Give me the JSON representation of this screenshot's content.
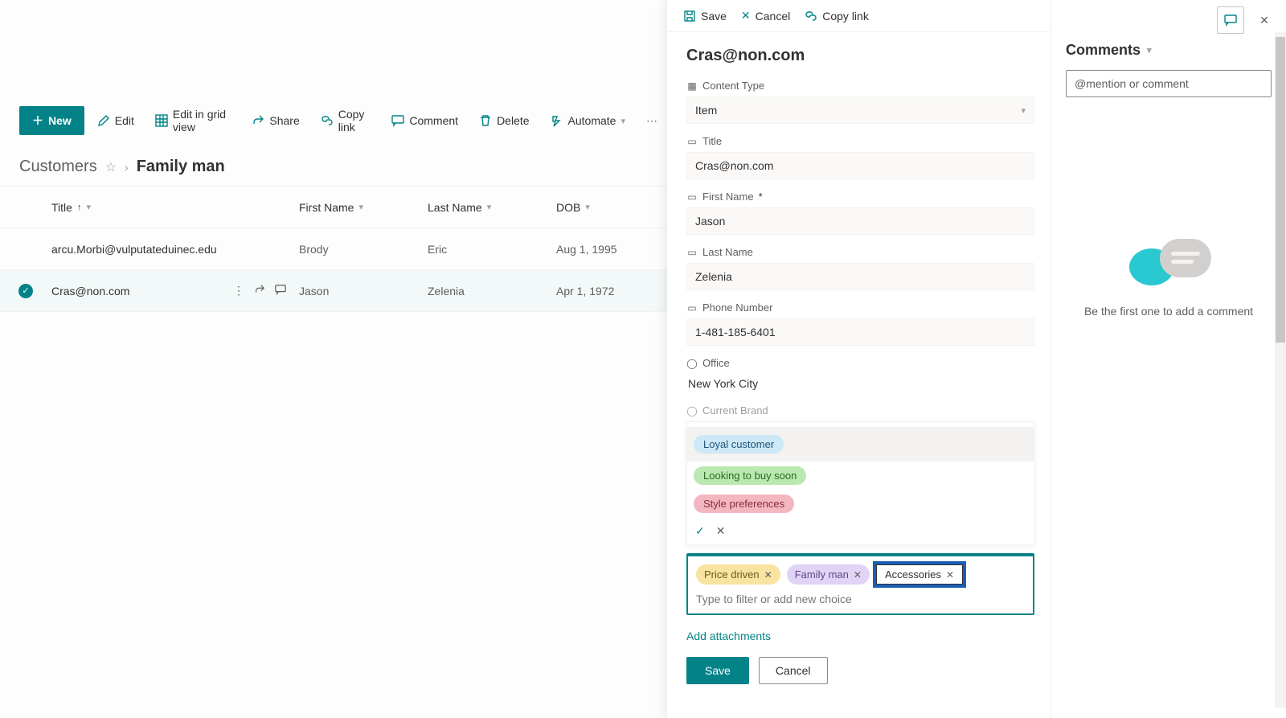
{
  "topbar": {
    "save": "Save",
    "cancel": "Cancel",
    "copylink": "Copy link"
  },
  "cmdbar": {
    "new": "New",
    "edit": "Edit",
    "editgrid": "Edit in grid view",
    "share": "Share",
    "copylink": "Copy link",
    "comment": "Comment",
    "delete": "Delete",
    "automate": "Automate"
  },
  "breadcrumb": {
    "root": "Customers",
    "current": "Family man"
  },
  "table": {
    "headers": {
      "title": "Title",
      "first": "First Name",
      "last": "Last Name",
      "dob": "DOB"
    },
    "rows": [
      {
        "title": "arcu.Morbi@vulputateduinec.edu",
        "first": "Brody",
        "last": "Eric",
        "dob": "Aug 1, 1995",
        "selected": false
      },
      {
        "title": "Cras@non.com",
        "first": "Jason",
        "last": "Zelenia",
        "dob": "Apr 1, 1972",
        "selected": true
      }
    ]
  },
  "panel": {
    "title": "Cras@non.com",
    "fields": {
      "contentType": {
        "label": "Content Type",
        "value": "Item"
      },
      "title": {
        "label": "Title",
        "value": "Cras@non.com"
      },
      "firstName": {
        "label": "First Name",
        "required": "*",
        "value": "Jason"
      },
      "lastName": {
        "label": "Last Name",
        "value": "Zelenia"
      },
      "phone": {
        "label": "Phone Number",
        "value": "1-481-185-6401"
      },
      "office": {
        "label": "Office",
        "value": "New York City"
      },
      "currentBrand": {
        "label": "Current Brand"
      }
    },
    "tagOptions": {
      "loyal": {
        "text": "Loyal customer",
        "bg": "#cde8f6",
        "fg": "#20547a"
      },
      "buysoon": {
        "text": "Looking to buy soon",
        "bg": "#b9e8b0",
        "fg": "#2a6b1e"
      },
      "style": {
        "text": "Style preferences",
        "bg": "#f4b6c1",
        "fg": "#8a2a3d"
      }
    },
    "selectedTags": {
      "price": {
        "text": "Price driven",
        "bg": "#f8e3a1",
        "fg": "#6b5b1b"
      },
      "family": {
        "text": "Family man",
        "bg": "#e0d3f5",
        "fg": "#5b4a8a"
      },
      "acc": {
        "text": "Accessories",
        "bg": "#ffffff",
        "fg": "#323130"
      }
    },
    "tagInputPlaceholder": "Type to filter or add new choice",
    "addAttachments": "Add attachments",
    "save": "Save",
    "cancel": "Cancel"
  },
  "comments": {
    "heading": "Comments",
    "placeholder": "@mention or comment",
    "empty": "Be the first one to add a comment"
  }
}
